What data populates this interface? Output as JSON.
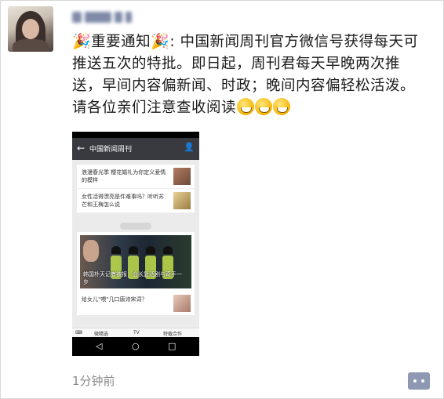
{
  "post": {
    "text_lead": "重要通知",
    "text_body": ": 中国新闻周刊官方微信号获得每天可推送五次的特批。即日起，周刊君每天早晚两次推送，早间内容偏新闻、时政；晚间内容偏轻松活泼。请各位亲们注意查收阅读",
    "party_emoji": "🎉",
    "timestamp": "1分钟前"
  },
  "embedded_screenshot": {
    "header_title": "中国新闻周刊",
    "articles": [
      {
        "title": "浪漫春光季 樱花婚礼为你定义爱情的模样"
      },
      {
        "title": "女性活得漂亮是件难事吗？听听苏芒和王梅怎么说"
      },
      {
        "title": "韩国朴天记者被报：会长复活剧与奇手一步"
      },
      {
        "title": "给女儿\"喂\"几口唐诗宋词？"
      }
    ],
    "tabs": [
      "微精选",
      "TV",
      "特载合作"
    ],
    "nav_buttons": [
      "◁",
      "○",
      "□"
    ]
  },
  "colors": {
    "link": "#576b95",
    "timestamp": "#8a8a8a",
    "comment_button": "#8e98b2"
  },
  "icons": [
    "avatar",
    "party-popper-icon",
    "grinning-face-icon",
    "comment-icon"
  ]
}
